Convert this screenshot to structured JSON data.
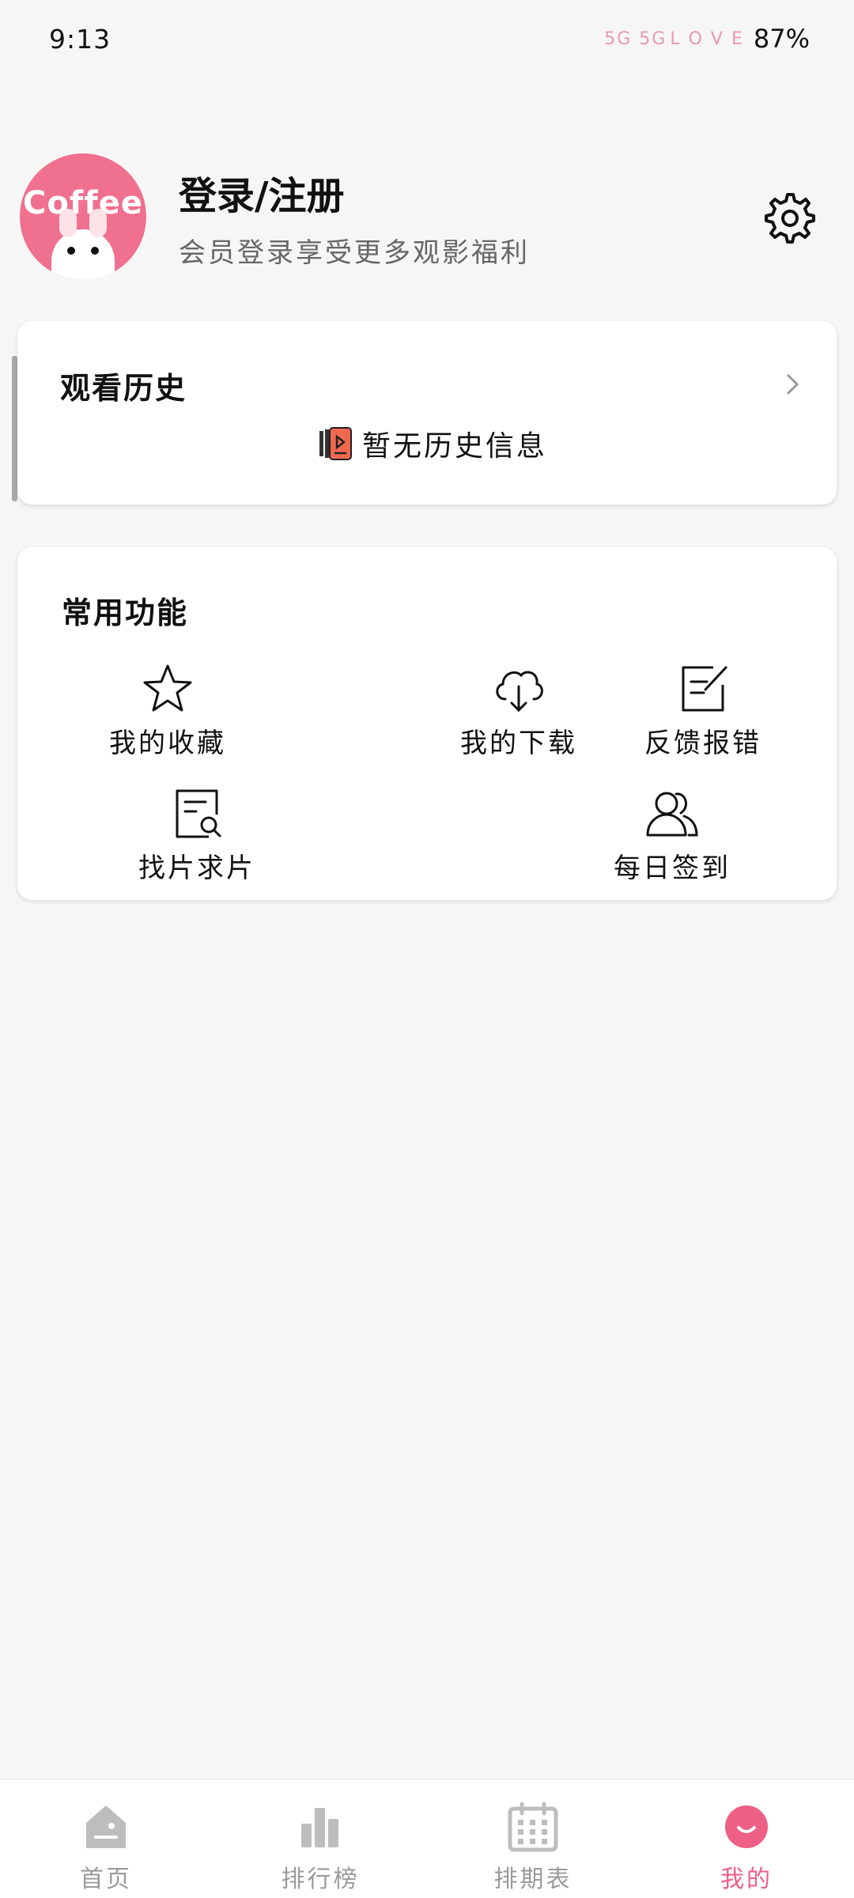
{
  "status_bar": {
    "time": "9:13",
    "network": "5G 5G",
    "decor": "L O V E",
    "battery": "87%"
  },
  "profile": {
    "avatar_text": "Coffee",
    "title": "登录/注册",
    "subtitle": "会员登录享受更多观影福利",
    "icon": "gear-icon"
  },
  "history": {
    "title": "观看历史",
    "empty_text": "暂无历史信息",
    "empty_icon": "video-book-icon"
  },
  "features": {
    "title": "常用功能",
    "items": [
      {
        "label": "我的收藏",
        "icon": "star-icon"
      },
      {
        "label": "我的下载",
        "icon": "cloud-download-icon"
      },
      {
        "label": "反馈报错",
        "icon": "edit-note-icon"
      },
      {
        "label": "找片求片",
        "icon": "document-search-icon"
      },
      {
        "label": "每日签到",
        "icon": "users-icon"
      }
    ]
  },
  "bottom_nav": {
    "items": [
      {
        "label": "首页",
        "icon": "home-icon"
      },
      {
        "label": "排行榜",
        "icon": "bar-chart-icon"
      },
      {
        "label": "排期表",
        "icon": "calendar-icon"
      },
      {
        "label": "我的",
        "icon": "smile-icon"
      }
    ],
    "active": "我的"
  },
  "colors": {
    "accent": "#ee5f86",
    "avatar_bg": "#f0708f",
    "inactive": "#9a9a9a",
    "background": "#f6f6f6"
  }
}
